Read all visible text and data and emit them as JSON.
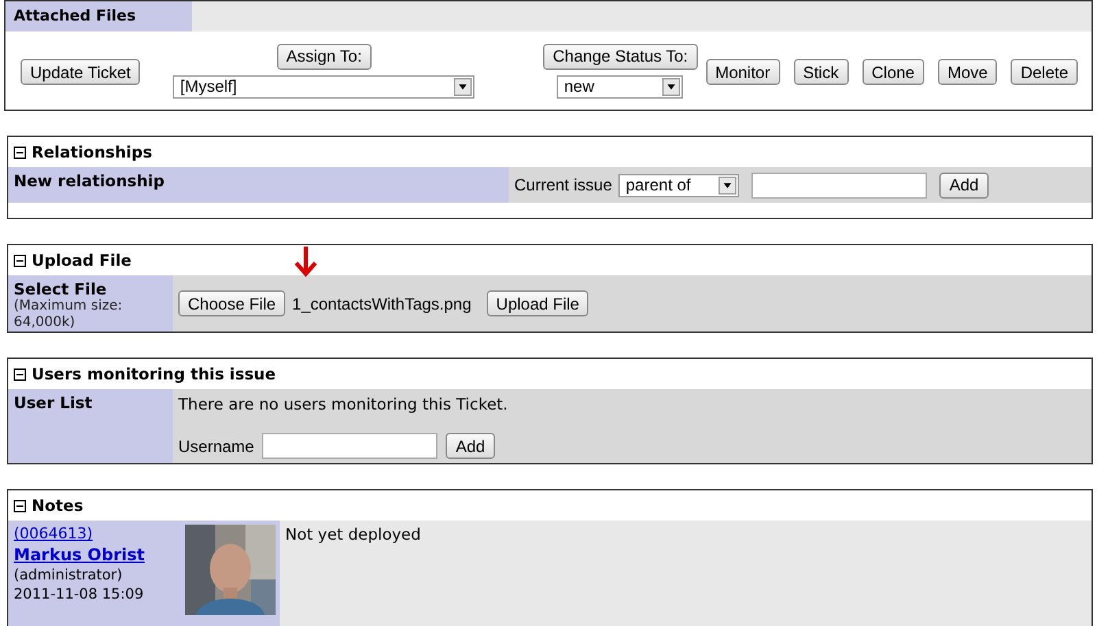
{
  "attached_files": {
    "title": "Attached Files"
  },
  "actions": {
    "update_button": "Update Ticket",
    "assign": {
      "button": "Assign To:",
      "value": "[Myself]"
    },
    "status": {
      "button": "Change Status To:",
      "value": "new"
    },
    "buttons": [
      "Monitor",
      "Stick",
      "Clone",
      "Move",
      "Delete"
    ]
  },
  "relationships": {
    "title": "Relationships",
    "label": "New relationship",
    "field_label": "Current issue",
    "relation": "parent of",
    "button": "Add"
  },
  "upload": {
    "title": "Upload File",
    "label": "Select File",
    "note": "(Maximum size: 64,000k)",
    "choose_button": "Choose File",
    "file_name": "1_contactsWithTags.png",
    "upload_button": "Upload File"
  },
  "monitoring": {
    "title": "Users monitoring this issue",
    "label": "User List",
    "message": "There are no users monitoring this Ticket.",
    "field_label": "Username",
    "button": "Add"
  },
  "notes": {
    "title": "Notes",
    "items": [
      {
        "id": "(0064613)",
        "author": "Markus Obrist",
        "role": "(administrator)",
        "date": "2011-11-08 15:09",
        "text": "Not yet deployed"
      }
    ]
  }
}
